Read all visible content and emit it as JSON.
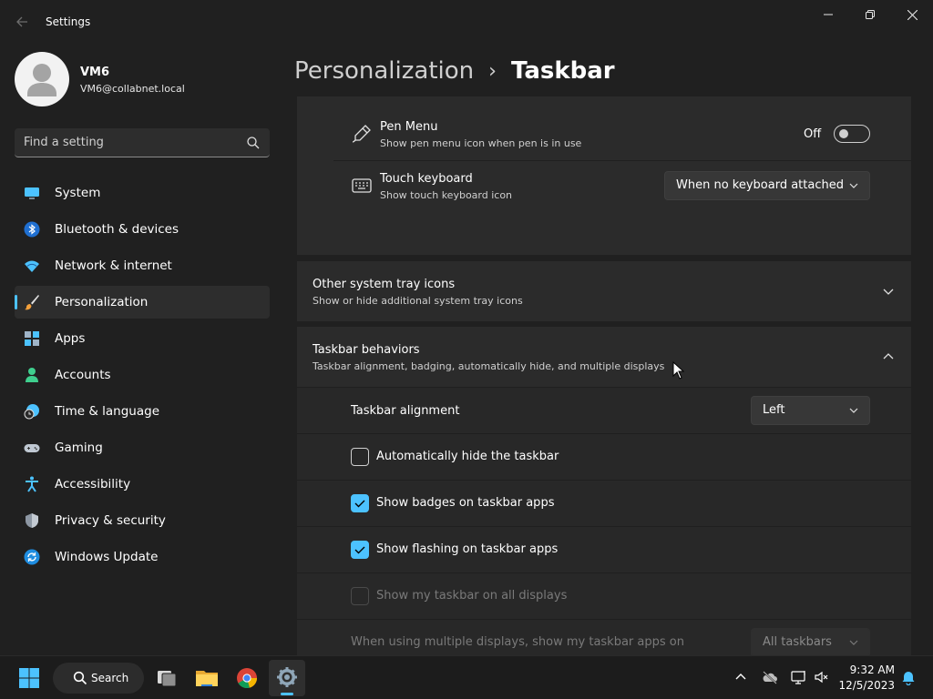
{
  "window": {
    "title": "Settings",
    "controls": {
      "minimize": "minimize",
      "maximize": "maximize",
      "close": "close"
    }
  },
  "user": {
    "name": "VM6",
    "email": "VM6@collabnet.local"
  },
  "search": {
    "placeholder": "Find a setting"
  },
  "sidebar": {
    "items": [
      {
        "label": "System",
        "icon": "system-icon"
      },
      {
        "label": "Bluetooth & devices",
        "icon": "bluetooth-icon"
      },
      {
        "label": "Network & internet",
        "icon": "wifi-icon"
      },
      {
        "label": "Personalization",
        "icon": "brush-icon",
        "active": true
      },
      {
        "label": "Apps",
        "icon": "apps-icon"
      },
      {
        "label": "Accounts",
        "icon": "person-icon"
      },
      {
        "label": "Time & language",
        "icon": "clock-globe-icon"
      },
      {
        "label": "Gaming",
        "icon": "gamepad-icon"
      },
      {
        "label": "Accessibility",
        "icon": "accessibility-icon"
      },
      {
        "label": "Privacy & security",
        "icon": "shield-icon"
      },
      {
        "label": "Windows Update",
        "icon": "update-icon"
      }
    ]
  },
  "header": {
    "parent": "Personalization",
    "separator": "›",
    "current": "Taskbar"
  },
  "pen_menu": {
    "title": "Pen Menu",
    "subtitle": "Show pen menu icon when pen is in use",
    "state_label": "Off",
    "on": false
  },
  "touch_keyboard": {
    "title": "Touch keyboard",
    "subtitle": "Show touch keyboard icon",
    "value": "When no keyboard attached"
  },
  "other_tray": {
    "title": "Other system tray icons",
    "subtitle": "Show or hide additional system tray icons",
    "expanded": false
  },
  "behaviors": {
    "title": "Taskbar behaviors",
    "subtitle": "Taskbar alignment, badging, automatically hide, and multiple displays",
    "expanded": true,
    "alignment": {
      "label": "Taskbar alignment",
      "value": "Left"
    },
    "auto_hide": {
      "label": "Automatically hide the taskbar",
      "checked": false
    },
    "badges": {
      "label": "Show badges on taskbar apps",
      "checked": true
    },
    "flashing": {
      "label": "Show flashing on taskbar apps",
      "checked": true
    },
    "all_displays": {
      "label": "Show my taskbar on all displays",
      "checked": false,
      "disabled": true
    },
    "multi_display": {
      "label": "When using multiple displays, show my taskbar apps on",
      "value": "All taskbars",
      "disabled": true
    }
  },
  "taskbar": {
    "search_label": "Search",
    "apps": [
      "start-icon",
      "task-view-icon",
      "file-explorer-icon",
      "chrome-icon",
      "settings-icon"
    ],
    "time": "9:32 AM",
    "date": "12/5/2023"
  },
  "colors": {
    "accent": "#4cc2ff",
    "background": "#202020",
    "card": "#2b2b2b"
  }
}
